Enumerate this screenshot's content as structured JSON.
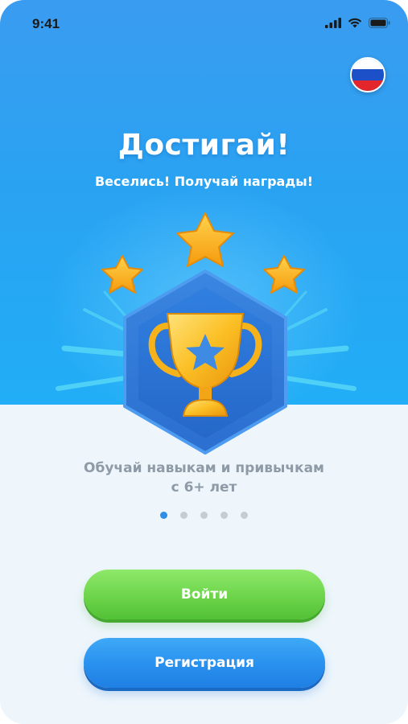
{
  "status_bar": {
    "time": "9:41"
  },
  "language": {
    "flag": "russia-flag",
    "colors": [
      "#ffffff",
      "#1c50c8",
      "#e3262c"
    ]
  },
  "onboarding": {
    "title": "Достигай!",
    "subtitle": "Веселись! Получай награды!",
    "illustration": "trophy-with-stars",
    "caption_line1": "Обучай навыкам и привычкам",
    "caption_line2": "с 6+ лет",
    "page_indicator": {
      "current": 1,
      "total": 5
    }
  },
  "actions": {
    "login_label": "Войти",
    "register_label": "Регистрация"
  },
  "colors": {
    "hero_blue": "#2aa2f2",
    "login_green": "#6cd44a",
    "register_blue": "#2890ee",
    "caption_gray": "#8e9aa6",
    "dot_active": "#2f8ee6",
    "dot_inactive": "#c6ccd2"
  }
}
